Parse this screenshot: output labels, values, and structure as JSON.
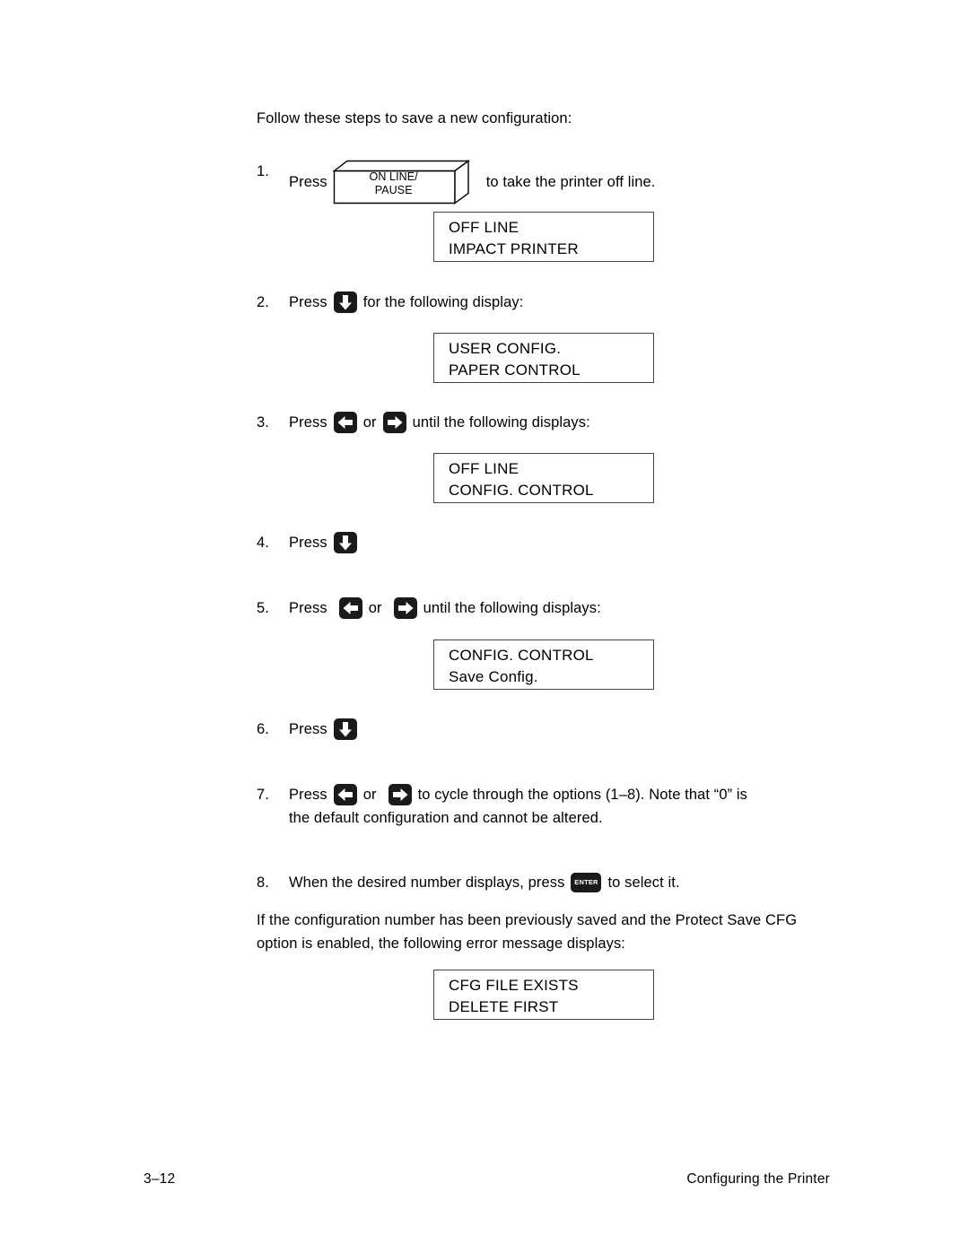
{
  "document": {
    "intro": "Follow these steps to save a new configuration:",
    "closing_paragraph_line1": "If the configuration number has been previously saved and the Protect Save CFG",
    "closing_paragraph_line2": "option is enabled, the following error message displays:"
  },
  "keys": {
    "online_pause_line1": "ON LINE/",
    "online_pause_line2": "PAUSE",
    "enter_label": "ENTER",
    "down_arrow": "down-arrow-key",
    "left_arrow": "left-arrow-key",
    "right_arrow": "right-arrow-key"
  },
  "steps": [
    {
      "number": "1.",
      "press_label": "Press",
      "after_text": "to take the printer off line."
    },
    {
      "number": "2.",
      "press_label": "Press",
      "after_text": "for the following display:"
    },
    {
      "number": "3.",
      "press_label": "Press",
      "or_label": "or",
      "after_text": "until the following displays:"
    },
    {
      "number": "4.",
      "press_label": "Press"
    },
    {
      "number": "5.",
      "press_label": "Press",
      "or_label": "or",
      "after_text": "until the following displays:"
    },
    {
      "number": "6.",
      "press_label": "Press"
    },
    {
      "number": "7.",
      "press_label": "Press",
      "or_label": "or",
      "after_text": "to cycle through the options (1–8). Note that “0” is",
      "second_line": "the default configuration and cannot be altered."
    },
    {
      "number": "8.",
      "before_text": "When the desired number displays, press",
      "after_text": "to select it."
    }
  ],
  "displays": [
    {
      "line1": "OFF LINE",
      "line2": "IMPACT PRINTER"
    },
    {
      "line1": "USER CONFIG.",
      "line2": "PAPER CONTROL"
    },
    {
      "line1": "OFF LINE",
      "line2": "CONFIG. CONTROL"
    },
    {
      "line1": "CONFIG. CONTROL",
      "line2": "Save Config."
    },
    {
      "line1": "CFG FILE EXISTS",
      "line2": "DELETE FIRST"
    }
  ],
  "footer": {
    "page_number": "3–12",
    "chapter_title": "Configuring the Printer"
  },
  "colors": {
    "text": "#000000",
    "key_fill": "#1a1a1a",
    "lcd_border": "#4b4049",
    "background": "#ffffff"
  }
}
